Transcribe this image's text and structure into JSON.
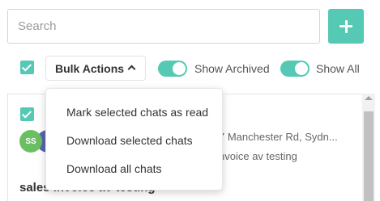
{
  "search": {
    "placeholder": "Search",
    "value": ""
  },
  "toolbar": {
    "bulk_actions_label": "Bulk Actions",
    "show_archived_label": "Show Archived",
    "show_archived_on": true,
    "show_all_label": "Show All",
    "show_all_on": true,
    "select_all_checked": true
  },
  "bulk_menu": {
    "items": [
      {
        "label": "Mark selected chats as read"
      },
      {
        "label": "Download selected chats"
      },
      {
        "label": "Download all chats"
      }
    ]
  },
  "chat_list": {
    "rows": [
      {
        "checked": true,
        "avatar_initials": "SS",
        "address": "7 Manchester Rd, Sydn...",
        "subject": "nvoice av testing",
        "title": "sales invoice av testing"
      }
    ]
  },
  "colors": {
    "accent": "#55c9b3",
    "avatar_primary": "#6abf62",
    "avatar_secondary": "#5a63b0"
  }
}
